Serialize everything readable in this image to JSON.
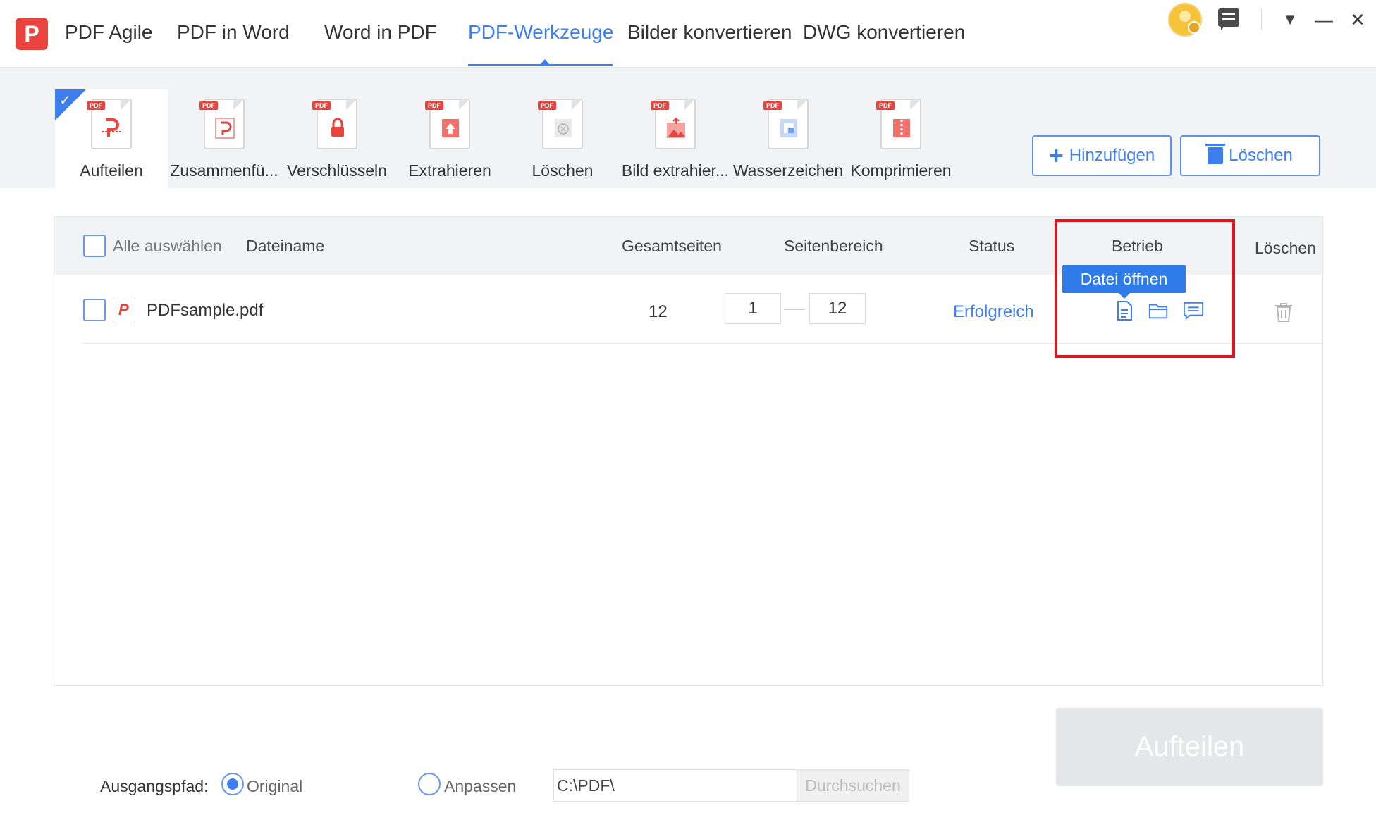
{
  "app": {
    "logo_letter": "P",
    "name": "PDF Agile"
  },
  "nav": {
    "tabs": [
      {
        "label": "PDF Agile"
      },
      {
        "label": "PDF in Word"
      },
      {
        "label": "Word in PDF"
      },
      {
        "label": "PDF-Werkzeuge",
        "active": true
      },
      {
        "label": "Bilder konvertieren"
      },
      {
        "label": "DWG konvertieren"
      }
    ]
  },
  "window_controls": {
    "menu": "▼",
    "minimize": "—",
    "close": "✕"
  },
  "tools": {
    "items": [
      {
        "label": "Aufteilen",
        "selected": true,
        "pdf_tag": "PDF"
      },
      {
        "label": "Zusammenfü...",
        "pdf_tag": "PDF"
      },
      {
        "label": "Verschlüsseln",
        "pdf_tag": "PDF"
      },
      {
        "label": "Extrahieren",
        "pdf_tag": "PDF"
      },
      {
        "label": "Löschen",
        "pdf_tag": "PDF"
      },
      {
        "label": "Bild extrahier...",
        "pdf_tag": "PDF"
      },
      {
        "label": "Wasserzeichen",
        "pdf_tag": "PDF"
      },
      {
        "label": "Komprimieren",
        "pdf_tag": "PDF"
      }
    ],
    "add_label": "Hinzufügen",
    "delete_label": "Löschen"
  },
  "table": {
    "headers": {
      "select_all": "Alle auswählen",
      "filename": "Dateiname",
      "total_pages": "Gesamtseiten",
      "page_range": "Seitenbereich",
      "status": "Status",
      "operation": "Betrieb",
      "delete": "Löschen"
    },
    "rows": [
      {
        "filename": "PDFsample.pdf",
        "total_pages": "12",
        "range_from": "1",
        "range_to": "12",
        "status": "Erfolgreich"
      }
    ],
    "tooltip": "Datei öffnen"
  },
  "output": {
    "label": "Ausgangspfad:",
    "option_original": "Original",
    "option_custom": "Anpassen",
    "path": "C:\\PDF\\",
    "browse_label": "Durchsuchen",
    "selected": "Original"
  },
  "action_button": "Aufteilen",
  "colors": {
    "accent": "#3e7ff0",
    "brand": "#e8433d",
    "highlight_box": "#e0131e"
  }
}
